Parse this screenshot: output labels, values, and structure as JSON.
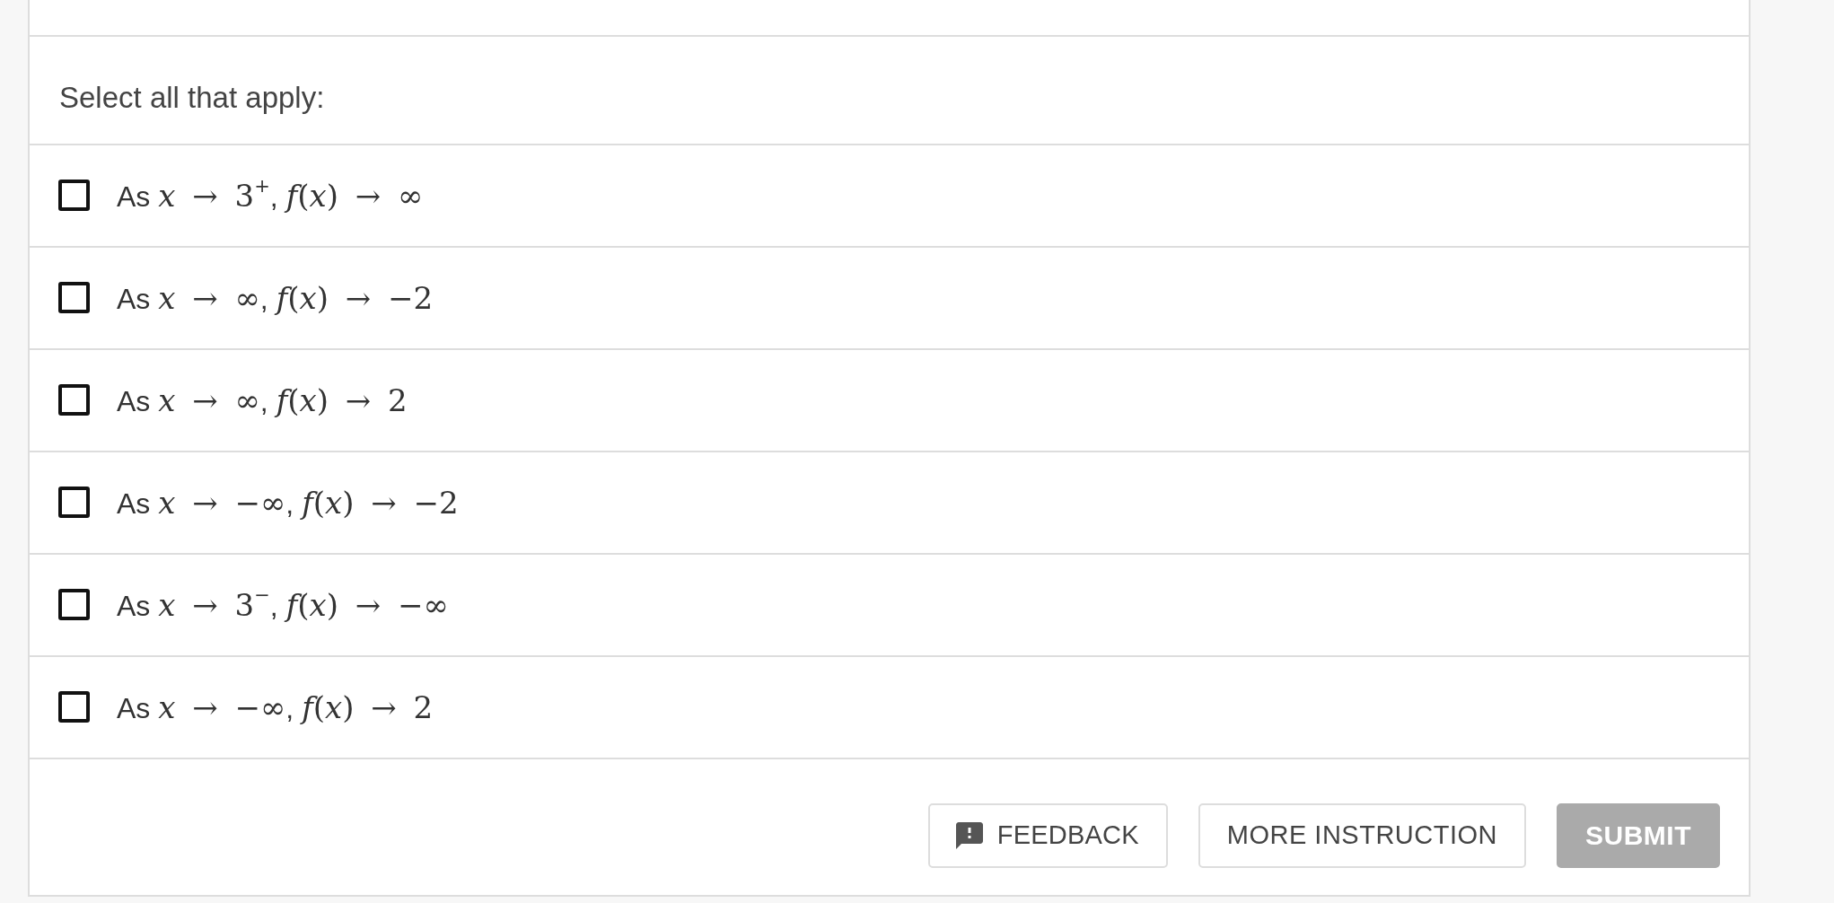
{
  "prompt": "Select all that apply:",
  "options": [
    {
      "checked": false,
      "label": [
        {
          "kind": "text",
          "text": "As "
        },
        {
          "kind": "math",
          "text": "*x* → 3$^{+}$"
        },
        {
          "kind": "text",
          "text": ", "
        },
        {
          "kind": "math",
          "text": "*f*(*x*) → ∞"
        }
      ]
    },
    {
      "checked": false,
      "label": [
        {
          "kind": "text",
          "text": "As "
        },
        {
          "kind": "math",
          "text": "*x* → ∞"
        },
        {
          "kind": "text",
          "text": ", "
        },
        {
          "kind": "math",
          "text": "*f*(*x*) → −2"
        }
      ]
    },
    {
      "checked": false,
      "label": [
        {
          "kind": "text",
          "text": "As "
        },
        {
          "kind": "math",
          "text": "*x* → ∞"
        },
        {
          "kind": "text",
          "text": ", "
        },
        {
          "kind": "math",
          "text": "*f*(*x*) → 2"
        }
      ]
    },
    {
      "checked": false,
      "label": [
        {
          "kind": "text",
          "text": "As "
        },
        {
          "kind": "math",
          "text": "*x* → −∞"
        },
        {
          "kind": "text",
          "text": ", "
        },
        {
          "kind": "math",
          "text": "*f*(*x*) → −2"
        }
      ]
    },
    {
      "checked": false,
      "label": [
        {
          "kind": "text",
          "text": "As "
        },
        {
          "kind": "math",
          "text": "*x* → 3$^{−}$"
        },
        {
          "kind": "text",
          "text": ", "
        },
        {
          "kind": "math",
          "text": "*f*(*x*) → −∞"
        }
      ]
    },
    {
      "checked": false,
      "label": [
        {
          "kind": "text",
          "text": "As "
        },
        {
          "kind": "math",
          "text": "*x* → −∞"
        },
        {
          "kind": "text",
          "text": ", "
        },
        {
          "kind": "math",
          "text": "*f*(*x*) → 2"
        }
      ]
    }
  ],
  "buttons": [
    {
      "kind": "feedback",
      "label": "FEEDBACK",
      "disabled": false
    },
    {
      "kind": "outline",
      "label": "MORE INSTRUCTION",
      "disabled": false
    },
    {
      "kind": "submit",
      "label": "SUBMIT",
      "disabled": true
    }
  ]
}
